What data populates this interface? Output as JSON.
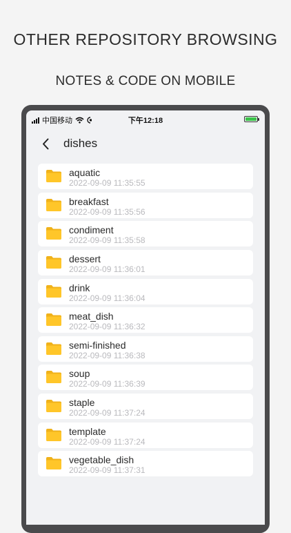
{
  "promo": {
    "title": "OTHER REPOSITORY BROWSING",
    "subtitle": "NOTES & CODE ON MOBILE"
  },
  "status_bar": {
    "carrier": "中国移动",
    "time": "下午12:18"
  },
  "nav": {
    "title": "dishes"
  },
  "files": [
    {
      "name": "aquatic",
      "date": "2022-09-09 11:35:55"
    },
    {
      "name": "breakfast",
      "date": "2022-09-09 11:35:56"
    },
    {
      "name": "condiment",
      "date": "2022-09-09 11:35:58"
    },
    {
      "name": "dessert",
      "date": "2022-09-09 11:36:01"
    },
    {
      "name": "drink",
      "date": "2022-09-09 11:36:04"
    },
    {
      "name": "meat_dish",
      "date": "2022-09-09 11:36:32"
    },
    {
      "name": "semi-finished",
      "date": "2022-09-09 11:36:38"
    },
    {
      "name": "soup",
      "date": "2022-09-09 11:36:39"
    },
    {
      "name": "staple",
      "date": "2022-09-09 11:37:24"
    },
    {
      "name": "template",
      "date": "2022-09-09 11:37:24"
    },
    {
      "name": "vegetable_dish",
      "date": "2022-09-09 11:37:31"
    }
  ],
  "colors": {
    "folder": "#ffc629",
    "folder_tab": "#f0b21a",
    "battery": "#3bc34a"
  },
  "icons": {
    "back": "chevron-left-icon",
    "folder": "folder-icon",
    "wifi": "wifi-icon",
    "battery": "battery-icon"
  }
}
